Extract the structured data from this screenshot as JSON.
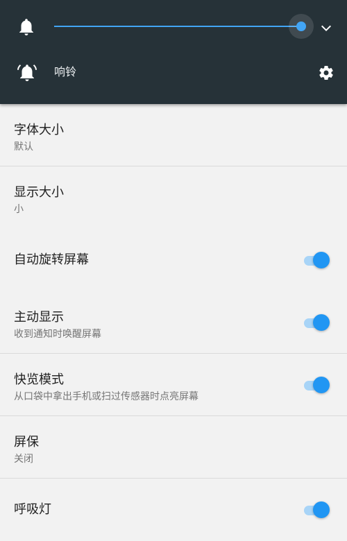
{
  "volume_panel": {
    "slider_level_percent": 99,
    "ringer_mode_label": "响铃",
    "accent_color": "#42a5f5",
    "background_color": "#263238",
    "icons": {
      "bell": "bell-icon",
      "expand": "chevron-down-icon",
      "ringer": "ringing-bell-icon",
      "settings": "gear-icon"
    }
  },
  "settings": [
    {
      "title": "字体大小",
      "summary": "默认"
    },
    {
      "title": "显示大小",
      "summary": "小"
    },
    {
      "title": "自动旋转屏幕",
      "toggle_on": true
    },
    {
      "title": "主动显示",
      "summary": "收到通知时唤醒屏幕",
      "toggle_on": true
    },
    {
      "title": "快览模式",
      "summary": "从口袋中拿出手机或扫过传感器时点亮屏幕",
      "toggle_on": true
    },
    {
      "title": "屏保",
      "summary": "关闭"
    },
    {
      "title": "呼吸灯",
      "toggle_on": true
    }
  ],
  "toggle_colors": {
    "on_thumb": "#2196f3",
    "on_track": "#a8d4f7"
  }
}
